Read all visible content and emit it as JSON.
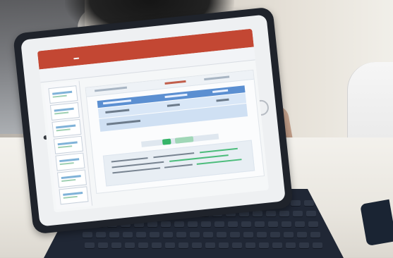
{
  "scene": {
    "description": "",
    "device": "tablet-with-keyboard"
  },
  "app": {
    "accent": "#c34733",
    "tabs": [],
    "slides_pane": {
      "thumb_count": 9
    }
  }
}
